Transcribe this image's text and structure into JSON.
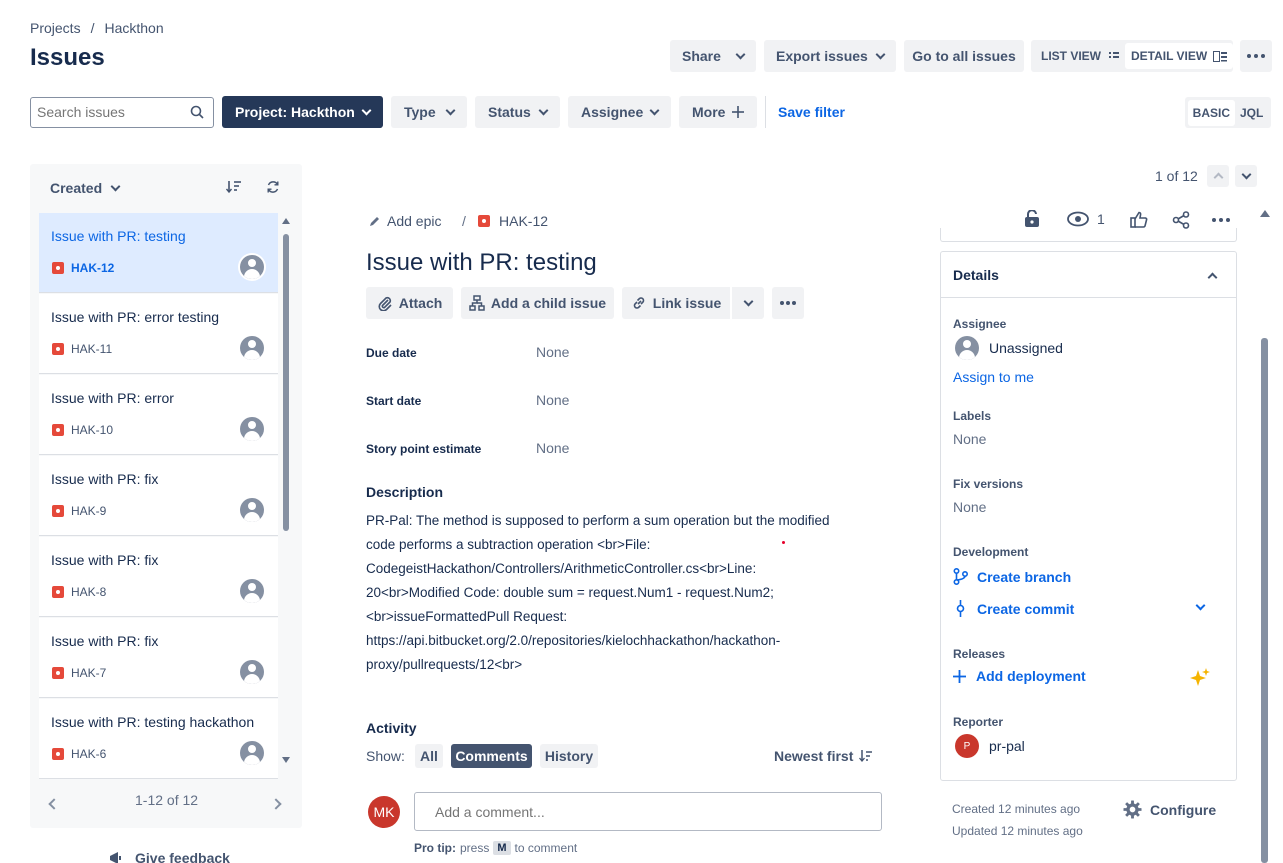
{
  "breadcrumb": {
    "projects": "Projects",
    "separator": "/",
    "project": "Hackthon"
  },
  "page_title": "Issues",
  "header_actions": {
    "share": "Share",
    "export": "Export issues",
    "go_all": "Go to all issues",
    "list_view": "LIST VIEW",
    "detail_view": "DETAIL VIEW"
  },
  "filters": {
    "search_placeholder": "Search issues",
    "project": "Project: Hackthon",
    "type": "Type",
    "status": "Status",
    "assignee": "Assignee",
    "more": "More",
    "save_filter": "Save filter",
    "basic": "BASIC",
    "jql": "JQL"
  },
  "list": {
    "sort_label": "Created",
    "pagination": "1-12 of 12",
    "feedback": "Give feedback",
    "items": [
      {
        "title": "Issue with PR: testing",
        "key": "HAK-12"
      },
      {
        "title": "Issue with PR: error testing",
        "key": "HAK-11"
      },
      {
        "title": "Issue with PR: error",
        "key": "HAK-10"
      },
      {
        "title": "Issue with PR: fix",
        "key": "HAK-9"
      },
      {
        "title": "Issue with PR: fix",
        "key": "HAK-8"
      },
      {
        "title": "Issue with PR: fix",
        "key": "HAK-7"
      },
      {
        "title": "Issue with PR: testing hackathon",
        "key": "HAK-6"
      }
    ]
  },
  "pager": {
    "text": "1 of 12"
  },
  "issue": {
    "add_epic": "Add epic",
    "sep": "/",
    "key": "HAK-12",
    "watchers": "1",
    "title": "Issue with PR: testing",
    "actions": {
      "attach": "Attach",
      "child": "Add a child issue",
      "link": "Link issue"
    },
    "fields": [
      {
        "label": "Due date",
        "value": "None"
      },
      {
        "label": "Start date",
        "value": "None"
      },
      {
        "label": "Story point estimate",
        "value": "None"
      }
    ],
    "description_label": "Description",
    "description_lines": [
      "PR-Pal: The method is supposed to perform a sum operation but the modified",
      "code performs a subtraction operation <br>File:",
      "CodegeistHackathon/Controllers/ArithmeticController.cs<br>Line:",
      "20<br>Modified Code: double sum = request.Num1 - request.Num2;",
      "<br>issueFormattedPull Request:",
      "https://api.bitbucket.org/2.0/repositories/kielochhackathon/hackathon-",
      "proxy/pullrequests/12<br>"
    ],
    "activity": {
      "label": "Activity",
      "show": "Show:",
      "all": "All",
      "comments": "Comments",
      "history": "History",
      "newest": "Newest first",
      "avatar_initials": "MK",
      "comment_placeholder": "Add a comment...",
      "protip_bold": "Pro tip:",
      "protip_press": "press",
      "protip_key": "M",
      "protip_rest": "to comment"
    }
  },
  "details": {
    "header": "Details",
    "assignee_label": "Assignee",
    "assignee_value": "Unassigned",
    "assign_me": "Assign to me",
    "labels_label": "Labels",
    "labels_value": "None",
    "fix_label": "Fix versions",
    "fix_value": "None",
    "dev_label": "Development",
    "create_branch": "Create branch",
    "create_commit": "Create commit",
    "releases_label": "Releases",
    "add_deployment": "Add deployment",
    "reporter_label": "Reporter",
    "reporter_initial": "P",
    "reporter_name": "pr-pal",
    "created": "Created 12 minutes ago",
    "updated": "Updated 12 minutes ago",
    "configure": "Configure"
  },
  "colors": {
    "primary_dark": "#253858",
    "link": "#0c66e4",
    "bug": "#e5493a",
    "selected": "#deebff"
  }
}
